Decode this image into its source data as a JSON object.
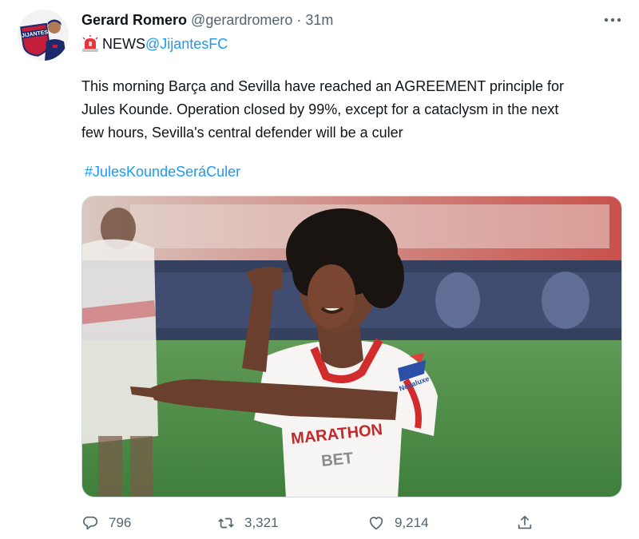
{
  "author": {
    "display_name": "Gerard Romero",
    "handle": "@gerardromero",
    "separator": "·",
    "time": "31m"
  },
  "subline": {
    "icon": "siren-icon",
    "label": "NEWS",
    "mention": "@JijantesFC"
  },
  "tweet": {
    "text": "This morning Barça and Sevilla have reached an AGREEMENT principle for\nJules Kounde. Operation closed by 99%, except for a cataclysm in the next\nfew hours, Sevilla's central defender will be a culer",
    "hashtag": "#JulesKoundeSeráCuler"
  },
  "media": {
    "shirt_sponsor_line1": "MARATHON",
    "shirt_sponsor_line2": "BET",
    "sleeve_sponsor": "Nevaluxe"
  },
  "actions": {
    "replies": "796",
    "retweets": "3,321",
    "likes": "9,214"
  },
  "colors": {
    "link": "#1d9bf0",
    "muted": "#536471",
    "text": "#0f1419"
  }
}
